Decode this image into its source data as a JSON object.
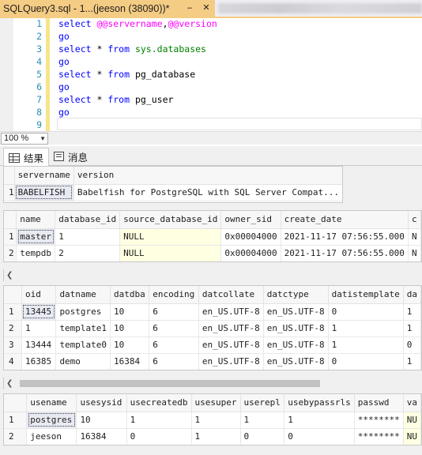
{
  "document_tab": {
    "title": "SQLQuery3.sql - 1...(jeeson (38090))*",
    "pin_icon": "pin-icon",
    "close_icon": "close-icon"
  },
  "editor": {
    "lines": [
      {
        "num": "1",
        "tokens": [
          {
            "t": "select ",
            "c": "kw"
          },
          {
            "t": "@@servername",
            "c": "gv"
          },
          {
            "t": ",",
            "c": "tx"
          },
          {
            "t": "@@version",
            "c": "gv"
          }
        ]
      },
      {
        "num": "2",
        "tokens": [
          {
            "t": "go",
            "c": "kw"
          }
        ]
      },
      {
        "num": "3",
        "tokens": [
          {
            "t": "select ",
            "c": "kw"
          },
          {
            "t": "* ",
            "c": "tx"
          },
          {
            "t": "from ",
            "c": "kw"
          },
          {
            "t": "sys.databases",
            "c": "ob"
          }
        ]
      },
      {
        "num": "4",
        "tokens": [
          {
            "t": "go",
            "c": "kw"
          }
        ]
      },
      {
        "num": "5",
        "tokens": [
          {
            "t": "select ",
            "c": "kw"
          },
          {
            "t": "* ",
            "c": "tx"
          },
          {
            "t": "from ",
            "c": "kw"
          },
          {
            "t": "pg_database",
            "c": "tx"
          }
        ]
      },
      {
        "num": "6",
        "tokens": [
          {
            "t": "go",
            "c": "kw"
          }
        ]
      },
      {
        "num": "7",
        "tokens": [
          {
            "t": "select ",
            "c": "kw"
          },
          {
            "t": "* ",
            "c": "tx"
          },
          {
            "t": "from ",
            "c": "kw"
          },
          {
            "t": "pg_user",
            "c": "tx"
          }
        ]
      },
      {
        "num": "8",
        "tokens": [
          {
            "t": "go",
            "c": "kw"
          }
        ]
      },
      {
        "num": "9",
        "tokens": []
      }
    ]
  },
  "zoom": {
    "value": "100 %"
  },
  "result_tabs": {
    "results_label": "结果",
    "messages_label": "消息"
  },
  "grids": [
    {
      "columns": [
        "",
        "servername",
        "version"
      ],
      "rows": [
        [
          "1",
          "BABELFISH",
          "Babelfish for PostgreSQL with SQL Server Compat..."
        ]
      ]
    },
    {
      "columns": [
        "",
        "name",
        "database_id",
        "source_database_id",
        "owner_sid",
        "create_date",
        "c"
      ],
      "rows": [
        [
          "1",
          "master",
          "1",
          "NULL",
          "0x00004000",
          "2021-11-17 07:56:55.000",
          "N"
        ],
        [
          "2",
          "tempdb",
          "2",
          "NULL",
          "0x00004000",
          "2021-11-17 07:56:55.000",
          "N"
        ]
      ]
    },
    {
      "columns": [
        "",
        "oid",
        "datname",
        "datdba",
        "encoding",
        "datcollate",
        "datctype",
        "datistemplate",
        "da"
      ],
      "rows": [
        [
          "1",
          "13445",
          "postgres",
          "10",
          "6",
          "en_US.UTF-8",
          "en_US.UTF-8",
          "0",
          "1"
        ],
        [
          "2",
          "1",
          "template1",
          "10",
          "6",
          "en_US.UTF-8",
          "en_US.UTF-8",
          "1",
          "1"
        ],
        [
          "3",
          "13444",
          "template0",
          "10",
          "6",
          "en_US.UTF-8",
          "en_US.UTF-8",
          "1",
          "0"
        ],
        [
          "4",
          "16385",
          "demo",
          "16384",
          "6",
          "en_US.UTF-8",
          "en_US.UTF-8",
          "0",
          "1"
        ]
      ]
    },
    {
      "columns": [
        "",
        "usename",
        "usesysid",
        "usecreatedb",
        "usesuper",
        "userepl",
        "usebypassrls",
        "passwd",
        "va"
      ],
      "rows": [
        [
          "1",
          "postgres",
          "10",
          "1",
          "1",
          "1",
          "1",
          "********",
          "NU"
        ],
        [
          "2",
          "jeeson",
          "16384",
          "0",
          "1",
          "0",
          "0",
          "********",
          "NU"
        ]
      ]
    }
  ]
}
